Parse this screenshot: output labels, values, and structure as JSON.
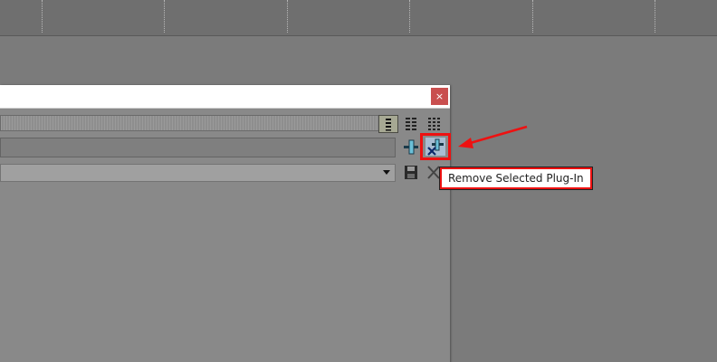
{
  "window": {
    "close_glyph": "×"
  },
  "toolbar": {
    "view_buttons": [
      "view-list-icon",
      "view-columns-icon",
      "view-grid-icon"
    ],
    "add_plugin_icon": "add-plugin-icon",
    "remove_plugin_icon": "remove-plugin-icon",
    "save_icon": "save-icon",
    "delete_icon": "delete-icon"
  },
  "tooltip": {
    "text": "Remove Selected Plug-In"
  },
  "colors": {
    "annotation": "#ee1111",
    "close_button": "#c94f4f",
    "active_view": "#a6a893"
  }
}
